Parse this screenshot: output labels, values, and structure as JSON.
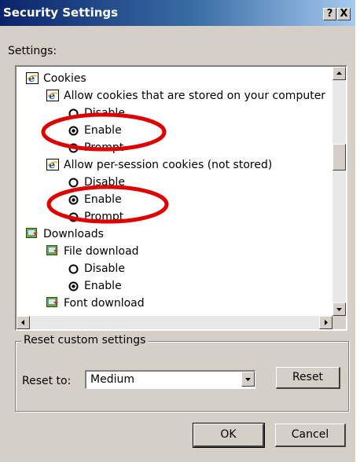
{
  "window": {
    "title": "Security Settings",
    "help_label": "?",
    "close_label": "X"
  },
  "settings_label": "Settings:",
  "tree": {
    "items": [
      {
        "label": "Cookies",
        "icon": "ie-icon",
        "type": "category"
      },
      {
        "label": "Allow cookies that are stored on your computer",
        "icon": "ie-icon",
        "type": "setting"
      },
      {
        "label": "Disable",
        "icon": "radio-empty-icon",
        "type": "option",
        "checked": false
      },
      {
        "label": "Enable",
        "icon": "radio-checked-icon",
        "type": "option",
        "checked": true,
        "highlighted": true
      },
      {
        "label": "Prompt",
        "icon": "radio-empty-icon",
        "type": "option",
        "checked": false
      },
      {
        "label": "Allow per-session cookies (not stored)",
        "icon": "ie-icon",
        "type": "setting"
      },
      {
        "label": "Disable",
        "icon": "radio-empty-icon",
        "type": "option",
        "checked": false
      },
      {
        "label": "Enable",
        "icon": "radio-checked-icon",
        "type": "option",
        "checked": true,
        "highlighted": true
      },
      {
        "label": "Prompt",
        "icon": "radio-empty-icon",
        "type": "option",
        "checked": false
      },
      {
        "label": "Downloads",
        "icon": "download-icon",
        "type": "category"
      },
      {
        "label": "File download",
        "icon": "download-icon",
        "type": "setting"
      },
      {
        "label": "Disable",
        "icon": "radio-empty-icon",
        "type": "option",
        "checked": false
      },
      {
        "label": "Enable",
        "icon": "radio-checked-icon",
        "type": "option",
        "checked": true
      },
      {
        "label": "Font download",
        "icon": "download-icon",
        "type": "setting"
      }
    ]
  },
  "reset_group": {
    "legend": "Reset custom settings",
    "reset_to_label": "Reset to:",
    "level_value": "Medium",
    "reset_button": "Reset"
  },
  "buttons": {
    "ok": "OK",
    "cancel": "Cancel"
  },
  "colors": {
    "highlight_ellipse": "#e00000",
    "title_bar": "#0a246a",
    "dialog_face": "#d4d0c8"
  }
}
